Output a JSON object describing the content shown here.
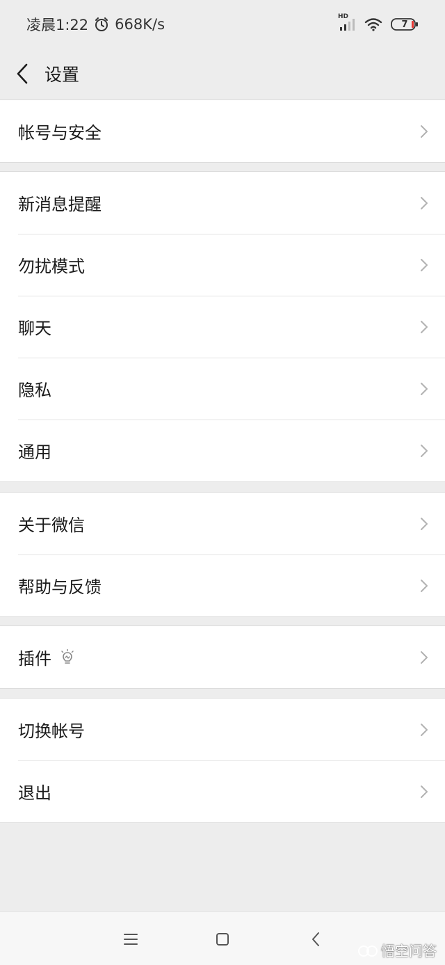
{
  "status_bar": {
    "time": "凌晨1:22",
    "speed": "668K/s",
    "network_label": "HD",
    "battery_level": "7"
  },
  "header": {
    "title": "设置"
  },
  "groups": [
    {
      "items": [
        {
          "label": "帐号与安全"
        }
      ]
    },
    {
      "items": [
        {
          "label": "新消息提醒"
        },
        {
          "label": "勿扰模式"
        },
        {
          "label": "聊天"
        },
        {
          "label": "隐私"
        },
        {
          "label": "通用"
        }
      ]
    },
    {
      "items": [
        {
          "label": "关于微信"
        },
        {
          "label": "帮助与反馈"
        }
      ]
    },
    {
      "items": [
        {
          "label": "插件",
          "icon": "lightbulb-icon"
        }
      ]
    },
    {
      "items": [
        {
          "label": "切换帐号"
        },
        {
          "label": "退出"
        }
      ]
    }
  ],
  "watermark": {
    "text": "悟空问答"
  },
  "colors": {
    "background": "#ededed",
    "card": "#ffffff",
    "divider": "#e3e3e3",
    "chevron": "#b2b2b2"
  }
}
